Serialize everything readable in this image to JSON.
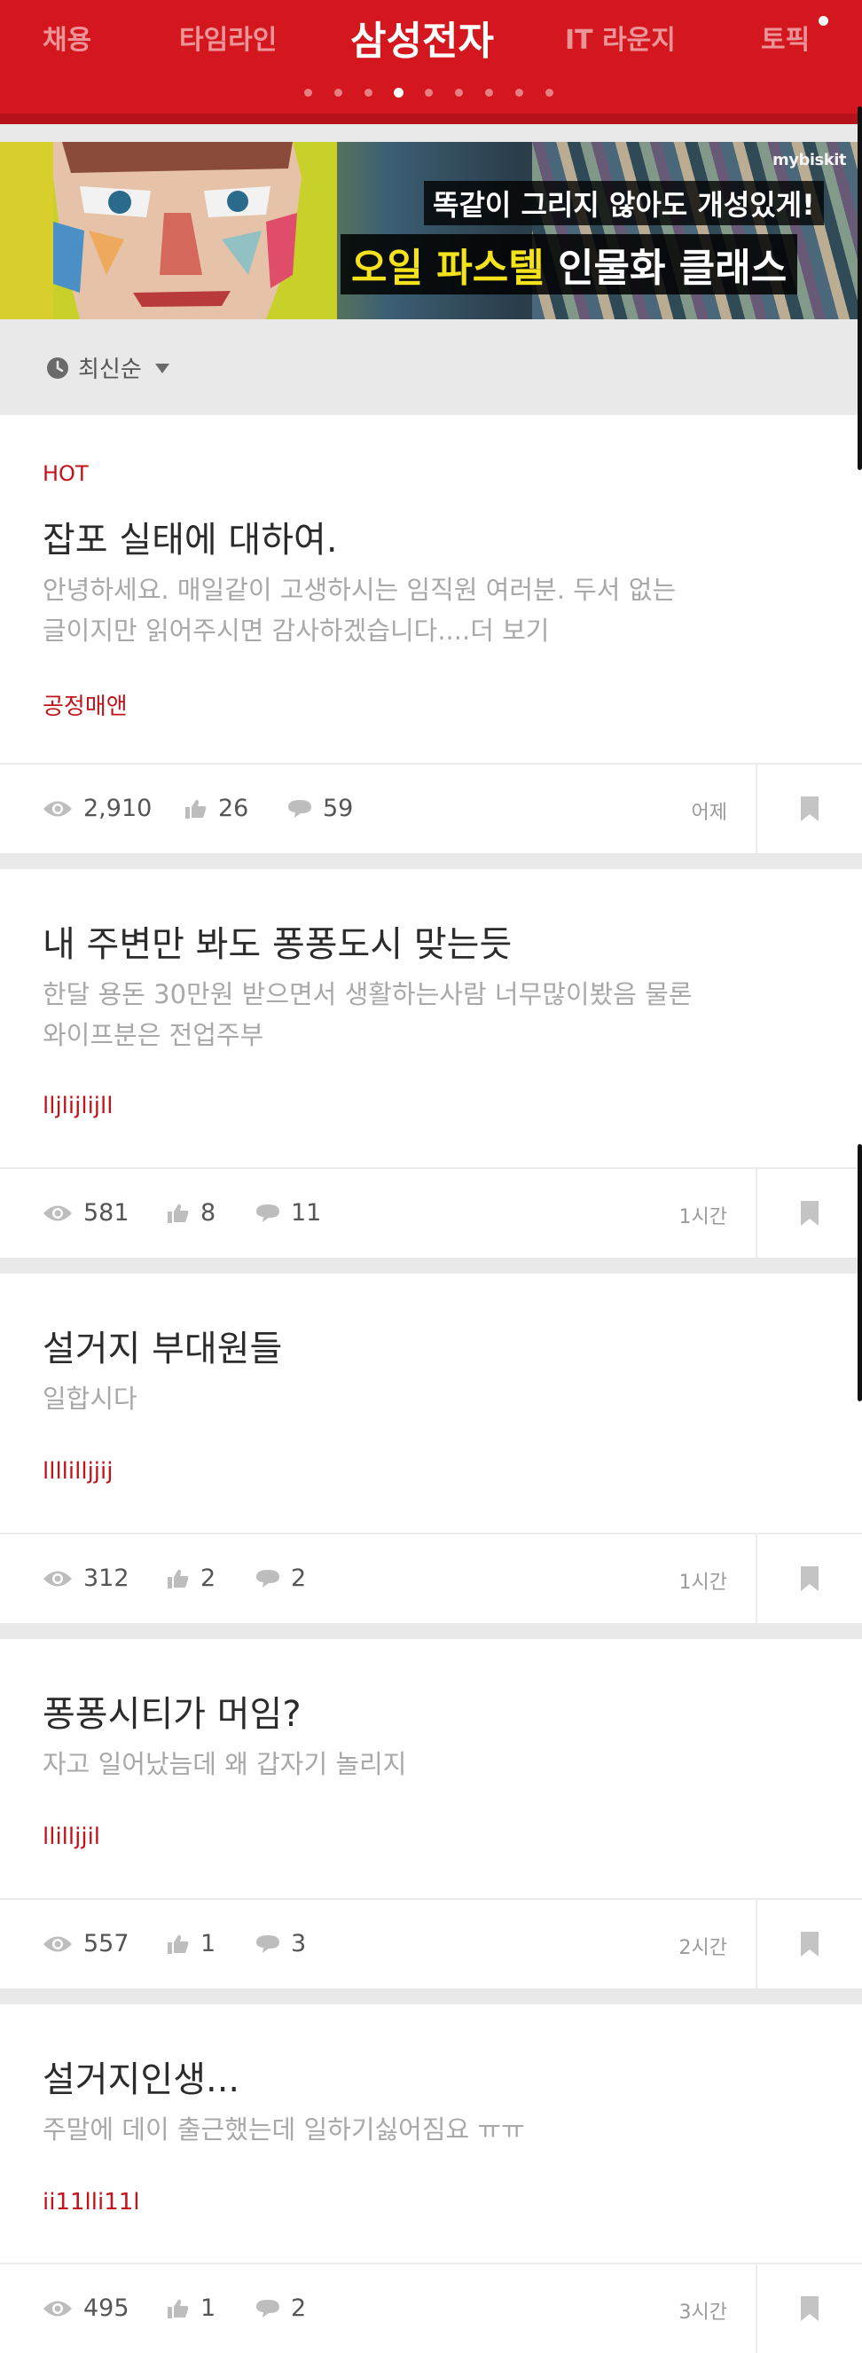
{
  "header": {
    "tabs": [
      {
        "label": "채용"
      },
      {
        "label": "타임라인"
      },
      {
        "label": "삼성전자"
      },
      {
        "label": "IT 라운지"
      },
      {
        "label": "토픽"
      }
    ],
    "active_tab": "삼성전자",
    "page_count": 9,
    "active_page": 4
  },
  "banner": {
    "brand": "mybiskit",
    "line1": "똑같이 그리지 않아도 개성있게!",
    "line2_highlight": "오일 파스텔",
    "line2_rest": "인물화 클래스"
  },
  "sort": {
    "label": "최신순",
    "icon": "clock-icon"
  },
  "posts": [
    {
      "badge": "HOT",
      "title": "잡포 실태에 대하여.",
      "preview": "안녕하세요. 매일같이 고생하시는 임직원 여러분. 두서 없는\n글이지만 읽어주시면 감사하겠습니다....더 보기",
      "author": "공정매앤",
      "views": "2,910",
      "likes": "26",
      "comments": "59",
      "time": "어제"
    },
    {
      "title": "내 주변만 봐도 퐁퐁도시 맞는듯",
      "preview": "한달 용돈 30만원 받으면서 생활하는사람 너무많이봤음 물론\n와이프분은 전업주부",
      "author": "lljlijlijll",
      "views": "581",
      "likes": "8",
      "comments": "11",
      "time": "1시간"
    },
    {
      "title": "설거지 부대원들",
      "preview": "일합시다",
      "author": "llllilljjij",
      "views": "312",
      "likes": "2",
      "comments": "2",
      "time": "1시간"
    },
    {
      "title": "퐁퐁시티가 머임?",
      "preview": "자고 일어났늠데  왜 갑자기 놀리지",
      "author": "llilljjil",
      "views": "557",
      "likes": "1",
      "comments": "3",
      "time": "2시간"
    },
    {
      "title": "설거지인생...",
      "preview": "주말에 데이 출근했는데 일하기싫어짐요 ㅠㅠ",
      "author": "ii11lli11l",
      "views": "495",
      "likes": "1",
      "comments": "2",
      "time": "3시간"
    }
  ],
  "colors": {
    "brand_red": "#d4161e",
    "accent_red": "#c2131a"
  }
}
